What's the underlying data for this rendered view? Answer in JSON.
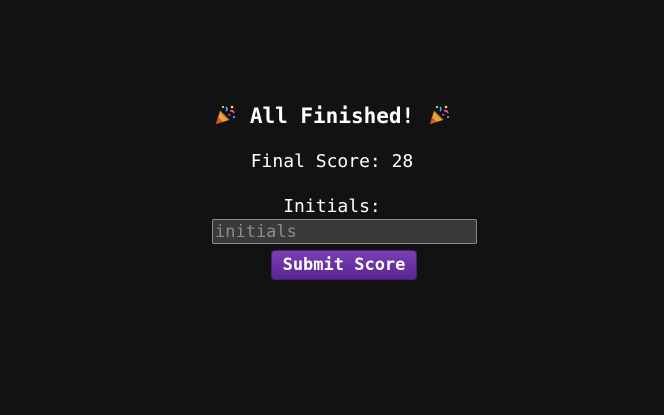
{
  "finish": {
    "title": "All Finished!",
    "icon_left": "party-popper-icon",
    "icon_right": "party-popper-icon"
  },
  "score": {
    "text": "Final Score: 28"
  },
  "form": {
    "initials_label": "Initials:",
    "initials_value": "",
    "initials_placeholder": "initials",
    "submit_label": "Submit Score"
  },
  "colors": {
    "background": "#121212",
    "text": "#ffffff",
    "input_bg": "#3a3a3a",
    "button_accent": "#6a30a0"
  }
}
